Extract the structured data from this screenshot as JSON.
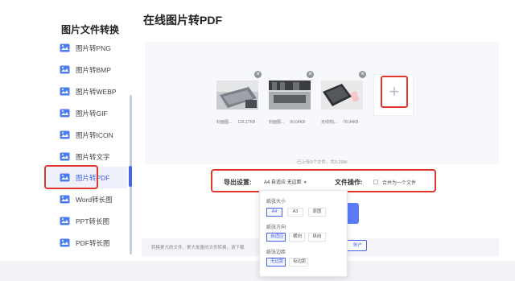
{
  "sidebar": {
    "title": "图片文件转换",
    "items": [
      {
        "label": "图片转PNG",
        "icon": "image-convert-icon"
      },
      {
        "label": "图片转BMP",
        "icon": "image-convert-icon"
      },
      {
        "label": "图片转WEBP",
        "icon": "image-convert-icon"
      },
      {
        "label": "图片转GIF",
        "icon": "image-convert-icon"
      },
      {
        "label": "图片转ICON",
        "icon": "image-convert-icon"
      },
      {
        "label": "图片转文字",
        "icon": "image-convert-icon"
      },
      {
        "label": "图片转PDF",
        "icon": "image-convert-icon",
        "active": true
      },
      {
        "label": "Word转长图",
        "icon": "word-convert-icon"
      },
      {
        "label": "PPT转长图",
        "icon": "ppt-convert-icon"
      },
      {
        "label": "PDF转长图",
        "icon": "pdf-convert-icon"
      }
    ]
  },
  "main": {
    "title": "在线图片转PDF",
    "files": [
      {
        "name": "封面图...",
        "size": "126.27KB"
      },
      {
        "name": "封面图...",
        "size": "90.04KB"
      },
      {
        "name": "无线权j...",
        "size": "78.94KB"
      }
    ],
    "add_icon": "plus-icon",
    "upload_status": "已上传3个文件，共0.29M",
    "settings": {
      "export_label": "导出设置:",
      "export_value": "A4 自适应 无边距",
      "file_op_label": "文件操作:",
      "merge_label": "合并为一个文件"
    },
    "info_text": "转换更大的文件、更大批量的文件转换，请下载",
    "account_button": "账户"
  },
  "dropdown": {
    "paper_size_label": "纸张大小",
    "paper_sizes": [
      {
        "label": "A4",
        "selected": true
      },
      {
        "label": "A3",
        "selected": false
      },
      {
        "label": "原图",
        "selected": false
      }
    ],
    "orientation_label": "纸张方向",
    "orientations": [
      {
        "label": "自适应",
        "selected": true
      },
      {
        "label": "横向",
        "selected": false
      },
      {
        "label": "纵向",
        "selected": false
      }
    ],
    "margin_label": "纸张边距",
    "margins": [
      {
        "label": "无边距",
        "selected": true
      },
      {
        "label": "有边距",
        "selected": false
      }
    ]
  },
  "colors": {
    "accent": "#4a64e8",
    "highlight_border": "#e0372c",
    "button_blue": "#5b7cfa"
  }
}
